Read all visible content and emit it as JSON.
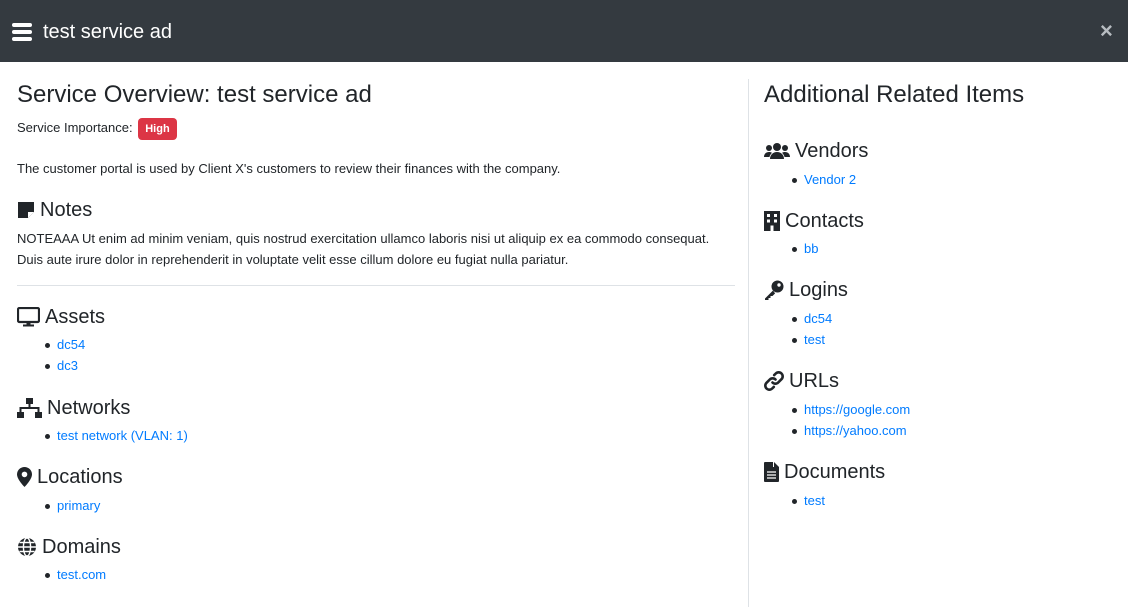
{
  "header": {
    "title": "test service ad"
  },
  "overview": {
    "title": "Service Overview: test service ad",
    "importance_label": "Service Importance:",
    "importance_value": "High",
    "description": "The customer portal is used by Client X's customers to review their finances with the company."
  },
  "notes": {
    "title": "Notes",
    "text": "NOTEAAA Ut enim ad minim veniam, quis nostrud exercitation ullamco laboris nisi ut aliquip ex ea commodo consequat. Duis aute irure dolor in reprehenderit in voluptate velit esse cillum dolore eu fugiat nulla pariatur."
  },
  "assets": {
    "title": "Assets",
    "items": [
      "dc54",
      "dc3"
    ]
  },
  "networks": {
    "title": "Networks",
    "items": [
      "test network (VLAN: 1)"
    ]
  },
  "locations": {
    "title": "Locations",
    "items": [
      "primary"
    ]
  },
  "domains": {
    "title": "Domains",
    "items": [
      "test.com"
    ]
  },
  "related": {
    "title": "Additional Related Items",
    "vendors": {
      "title": "Vendors",
      "items": [
        "Vendor 2"
      ]
    },
    "contacts": {
      "title": "Contacts",
      "items": [
        "bb"
      ]
    },
    "logins": {
      "title": "Logins",
      "items": [
        "dc54",
        "test"
      ]
    },
    "urls": {
      "title": "URLs",
      "items": [
        "https://google.com",
        "https://yahoo.com"
      ]
    },
    "documents": {
      "title": "Documents",
      "items": [
        "test"
      ]
    }
  },
  "colors": {
    "header_bg": "#343a40",
    "link": "#007bff",
    "badge_danger": "#dc3545"
  },
  "icons": [
    "menu-icon",
    "close-icon",
    "sticky-note-icon",
    "desktop-icon",
    "network-icon",
    "map-marker-icon",
    "globe-icon",
    "users-icon",
    "building-icon",
    "key-icon",
    "link-icon",
    "file-icon"
  ]
}
